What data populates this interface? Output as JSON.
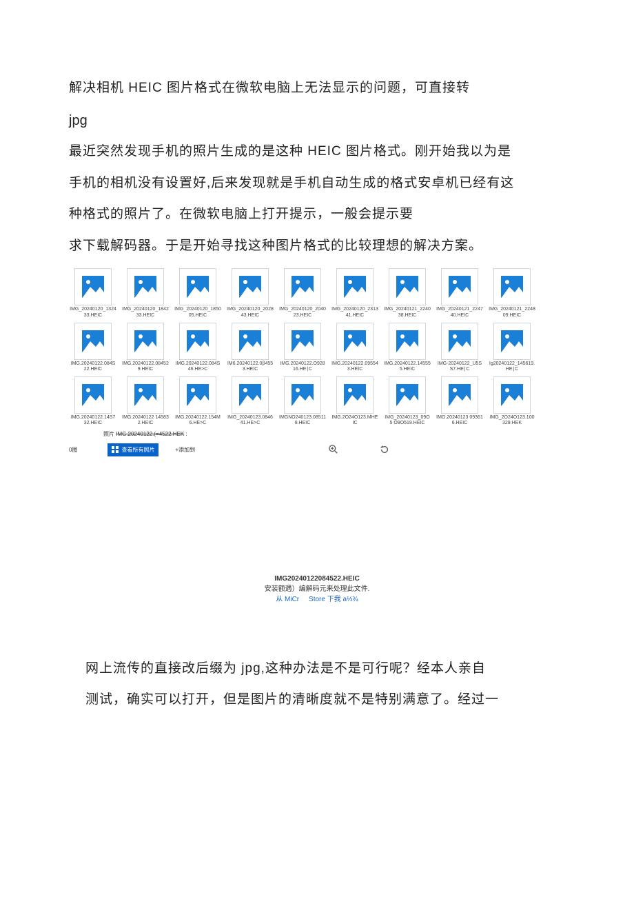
{
  "title": "解决相机 HEIC 图片格式在微软电脑上无法显示的问题，可直接转",
  "jpg": "jpg",
  "para1a": "最近突然发现手机的照片生成的是这种 HEIC 图片格式。刚开始我以为是",
  "para1b": "手机的相机没有设置好,后来发现就是手机自动生成的格式安卓机已经有这",
  "para1c": "种格式的照片了。在微软电脑上打开提示，一般会提示要",
  "para1d": "求下载解码器。于是开始寻找这种图片格式的比较理想的解决方案。",
  "files_row1": [
    "IMG_20240120_132433.HEIC",
    "IMG_20240120_184233.HEIC",
    "IMG_20240120_185005.HEIC",
    "IMG_20240120_202843.HEIC",
    "IMG_20240120_204023.HEIC",
    "IMG_20240120_231341.HEIC",
    "IMG_20240121_224038.HEIC",
    "IMG_20240121_224740.HEIC",
    "IMG_20240121_224809.HEIC"
  ],
  "files_row2": [
    "IMG.20240122.084S22.HEIC",
    "IMG.20240122.084529.HEIC",
    "IMG.20240122.084S46.HE>C",
    "IM6.20240122.0β4553.HEIC",
    "IMG.20240122.O92816.HE∣C",
    "IMG.20240122.095543.HEIC",
    "IMG.20240122.145555.HEIC",
    "IMG-20240122_U5SS7.HE∣C",
    "Ig20240122_145619.HE∣C"
  ],
  "files_row3": [
    "IMG.20240122.14S732.HEIC",
    "IMG.20240122 145832.HEIC",
    "IMG.20240122.154M6.HE>C",
    "IMG_20240123.084641.HE>C",
    "IMGNO240123.085118.HEIC",
    "IMG.2O24O123.MHEIC",
    "IMG_20240123_09O5 O9O519.HEIC",
    "IMG.20240123 093616.HEIC",
    "IMG_2O24O123.100329.HEK"
  ],
  "photos_bar": {
    "left_label": "0图",
    "title_prefix": "照片 ",
    "title_file": "IMG.20240122.(=4522.HEK",
    "title_suffix": " :",
    "view_all": "查看所有照片",
    "add_to": "+添加到"
  },
  "codec": {
    "filename": "IMG20240122084522.HEIC",
    "msg": "安装额遇）编解码元来处理此文件.",
    "link1": "从 MiCr",
    "link2": "Store 下我 a⅓¾"
  },
  "para2a": "网上流传的直接改后缀为 jpg,这种办法是不是可行呢？经本人亲自",
  "para2b": "测试，确实可以打开，但是图片的清晰度就不是特别满意了。经过一"
}
